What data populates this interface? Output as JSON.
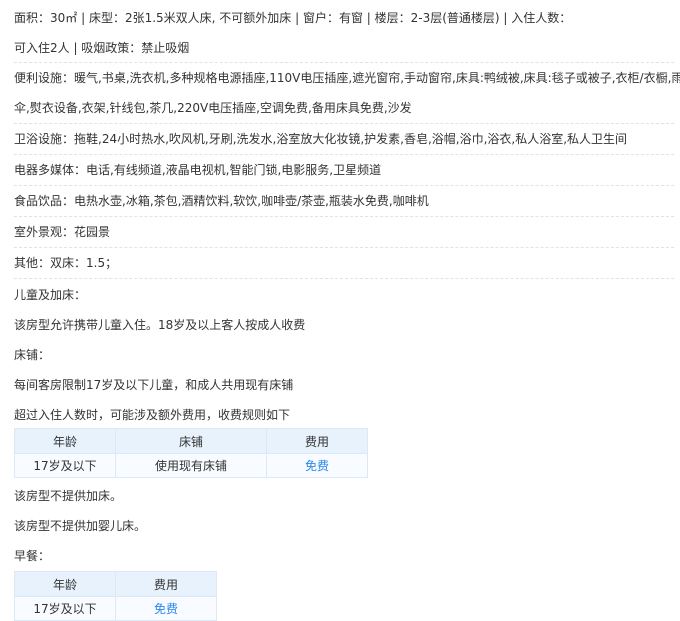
{
  "room": {
    "line1": "面积：30㎡ | 床型：2张1.5米双人床, 不可额外加床 | 窗户：有窗 | 楼层：2-3层(普通楼层) | 入住人数：",
    "line2": "可入住2人 | 吸烟政策：禁止吸烟",
    "facilities_line1": "便利设施：暖气,书桌,洗衣机,多种规格电源插座,110V电压插座,遮光窗帘,手动窗帘,床具:鸭绒被,床具:毯子或被子,衣柜/衣橱,雨",
    "facilities_line2": "伞,熨衣设备,衣架,针线包,茶几,220V电压插座,空调免费,备用床具免费,沙发",
    "bath": "卫浴设施：拖鞋,24小时热水,吹风机,牙刷,洗发水,浴室放大化妆镜,护发素,香皂,浴帽,浴巾,浴衣,私人浴室,私人卫生间",
    "media": "电器多媒体：电话,有线频道,液晶电视机,智能门锁,电影服务,卫星频道",
    "food": "食品饮品：电热水壶,冰箱,茶包,酒精饮料,软饮,咖啡壶/茶壶,瓶装水免费,咖啡机",
    "view": "室外景观：花园景",
    "other": "其他：双床：1.5；"
  },
  "children": {
    "heading": "儿童及加床：",
    "policy": "该房型允许携带儿童入住。18岁及以上客人按成人收费",
    "bed_heading": "床铺：",
    "bed_rule": "每间客房限制17岁及以下儿童，和成人共用现有床铺",
    "extra_rule": "超过入住人数时，可能涉及额外费用，收费规则如下",
    "bed_table": {
      "headers": [
        "年龄",
        "床铺",
        "费用"
      ],
      "rows": [
        [
          "17岁及以下",
          "使用现有床铺",
          "免费"
        ]
      ]
    },
    "no_extra_bed": "该房型不提供加床。",
    "no_crib": "该房型不提供加婴儿床。"
  },
  "breakfast": {
    "heading": "早餐：",
    "table": {
      "headers": [
        "年龄",
        "费用"
      ],
      "rows": [
        [
          "17岁及以下",
          "免费"
        ]
      ]
    }
  },
  "colors": {
    "free": "#2a86e8",
    "table_header": "#e8f2fd"
  }
}
